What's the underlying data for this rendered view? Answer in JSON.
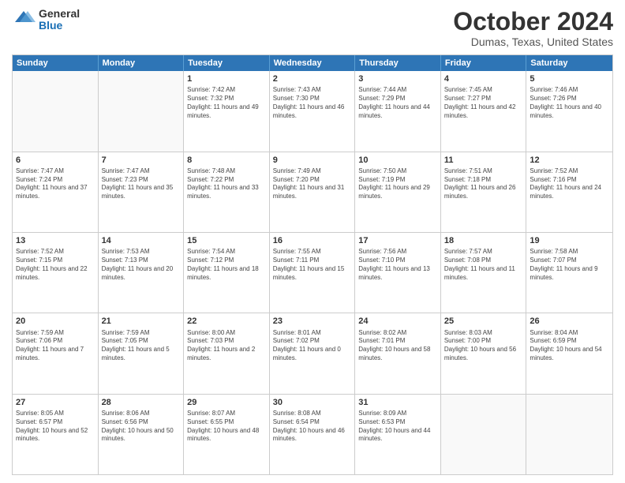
{
  "header": {
    "logo_general": "General",
    "logo_blue": "Blue",
    "month_title": "October 2024",
    "location": "Dumas, Texas, United States"
  },
  "calendar": {
    "weekdays": [
      "Sunday",
      "Monday",
      "Tuesday",
      "Wednesday",
      "Thursday",
      "Friday",
      "Saturday"
    ],
    "rows": [
      [
        {
          "day": "",
          "sunrise": "",
          "sunset": "",
          "daylight": "",
          "empty": true
        },
        {
          "day": "",
          "sunrise": "",
          "sunset": "",
          "daylight": "",
          "empty": true
        },
        {
          "day": "1",
          "sunrise": "Sunrise: 7:42 AM",
          "sunset": "Sunset: 7:32 PM",
          "daylight": "Daylight: 11 hours and 49 minutes."
        },
        {
          "day": "2",
          "sunrise": "Sunrise: 7:43 AM",
          "sunset": "Sunset: 7:30 PM",
          "daylight": "Daylight: 11 hours and 46 minutes."
        },
        {
          "day": "3",
          "sunrise": "Sunrise: 7:44 AM",
          "sunset": "Sunset: 7:29 PM",
          "daylight": "Daylight: 11 hours and 44 minutes."
        },
        {
          "day": "4",
          "sunrise": "Sunrise: 7:45 AM",
          "sunset": "Sunset: 7:27 PM",
          "daylight": "Daylight: 11 hours and 42 minutes."
        },
        {
          "day": "5",
          "sunrise": "Sunrise: 7:46 AM",
          "sunset": "Sunset: 7:26 PM",
          "daylight": "Daylight: 11 hours and 40 minutes."
        }
      ],
      [
        {
          "day": "6",
          "sunrise": "Sunrise: 7:47 AM",
          "sunset": "Sunset: 7:24 PM",
          "daylight": "Daylight: 11 hours and 37 minutes."
        },
        {
          "day": "7",
          "sunrise": "Sunrise: 7:47 AM",
          "sunset": "Sunset: 7:23 PM",
          "daylight": "Daylight: 11 hours and 35 minutes."
        },
        {
          "day": "8",
          "sunrise": "Sunrise: 7:48 AM",
          "sunset": "Sunset: 7:22 PM",
          "daylight": "Daylight: 11 hours and 33 minutes."
        },
        {
          "day": "9",
          "sunrise": "Sunrise: 7:49 AM",
          "sunset": "Sunset: 7:20 PM",
          "daylight": "Daylight: 11 hours and 31 minutes."
        },
        {
          "day": "10",
          "sunrise": "Sunrise: 7:50 AM",
          "sunset": "Sunset: 7:19 PM",
          "daylight": "Daylight: 11 hours and 29 minutes."
        },
        {
          "day": "11",
          "sunrise": "Sunrise: 7:51 AM",
          "sunset": "Sunset: 7:18 PM",
          "daylight": "Daylight: 11 hours and 26 minutes."
        },
        {
          "day": "12",
          "sunrise": "Sunrise: 7:52 AM",
          "sunset": "Sunset: 7:16 PM",
          "daylight": "Daylight: 11 hours and 24 minutes."
        }
      ],
      [
        {
          "day": "13",
          "sunrise": "Sunrise: 7:52 AM",
          "sunset": "Sunset: 7:15 PM",
          "daylight": "Daylight: 11 hours and 22 minutes."
        },
        {
          "day": "14",
          "sunrise": "Sunrise: 7:53 AM",
          "sunset": "Sunset: 7:13 PM",
          "daylight": "Daylight: 11 hours and 20 minutes."
        },
        {
          "day": "15",
          "sunrise": "Sunrise: 7:54 AM",
          "sunset": "Sunset: 7:12 PM",
          "daylight": "Daylight: 11 hours and 18 minutes."
        },
        {
          "day": "16",
          "sunrise": "Sunrise: 7:55 AM",
          "sunset": "Sunset: 7:11 PM",
          "daylight": "Daylight: 11 hours and 15 minutes."
        },
        {
          "day": "17",
          "sunrise": "Sunrise: 7:56 AM",
          "sunset": "Sunset: 7:10 PM",
          "daylight": "Daylight: 11 hours and 13 minutes."
        },
        {
          "day": "18",
          "sunrise": "Sunrise: 7:57 AM",
          "sunset": "Sunset: 7:08 PM",
          "daylight": "Daylight: 11 hours and 11 minutes."
        },
        {
          "day": "19",
          "sunrise": "Sunrise: 7:58 AM",
          "sunset": "Sunset: 7:07 PM",
          "daylight": "Daylight: 11 hours and 9 minutes."
        }
      ],
      [
        {
          "day": "20",
          "sunrise": "Sunrise: 7:59 AM",
          "sunset": "Sunset: 7:06 PM",
          "daylight": "Daylight: 11 hours and 7 minutes."
        },
        {
          "day": "21",
          "sunrise": "Sunrise: 7:59 AM",
          "sunset": "Sunset: 7:05 PM",
          "daylight": "Daylight: 11 hours and 5 minutes."
        },
        {
          "day": "22",
          "sunrise": "Sunrise: 8:00 AM",
          "sunset": "Sunset: 7:03 PM",
          "daylight": "Daylight: 11 hours and 2 minutes."
        },
        {
          "day": "23",
          "sunrise": "Sunrise: 8:01 AM",
          "sunset": "Sunset: 7:02 PM",
          "daylight": "Daylight: 11 hours and 0 minutes."
        },
        {
          "day": "24",
          "sunrise": "Sunrise: 8:02 AM",
          "sunset": "Sunset: 7:01 PM",
          "daylight": "Daylight: 10 hours and 58 minutes."
        },
        {
          "day": "25",
          "sunrise": "Sunrise: 8:03 AM",
          "sunset": "Sunset: 7:00 PM",
          "daylight": "Daylight: 10 hours and 56 minutes."
        },
        {
          "day": "26",
          "sunrise": "Sunrise: 8:04 AM",
          "sunset": "Sunset: 6:59 PM",
          "daylight": "Daylight: 10 hours and 54 minutes."
        }
      ],
      [
        {
          "day": "27",
          "sunrise": "Sunrise: 8:05 AM",
          "sunset": "Sunset: 6:57 PM",
          "daylight": "Daylight: 10 hours and 52 minutes."
        },
        {
          "day": "28",
          "sunrise": "Sunrise: 8:06 AM",
          "sunset": "Sunset: 6:56 PM",
          "daylight": "Daylight: 10 hours and 50 minutes."
        },
        {
          "day": "29",
          "sunrise": "Sunrise: 8:07 AM",
          "sunset": "Sunset: 6:55 PM",
          "daylight": "Daylight: 10 hours and 48 minutes."
        },
        {
          "day": "30",
          "sunrise": "Sunrise: 8:08 AM",
          "sunset": "Sunset: 6:54 PM",
          "daylight": "Daylight: 10 hours and 46 minutes."
        },
        {
          "day": "31",
          "sunrise": "Sunrise: 8:09 AM",
          "sunset": "Sunset: 6:53 PM",
          "daylight": "Daylight: 10 hours and 44 minutes."
        },
        {
          "day": "",
          "sunrise": "",
          "sunset": "",
          "daylight": "",
          "empty": true
        },
        {
          "day": "",
          "sunrise": "",
          "sunset": "",
          "daylight": "",
          "empty": true
        }
      ]
    ]
  }
}
